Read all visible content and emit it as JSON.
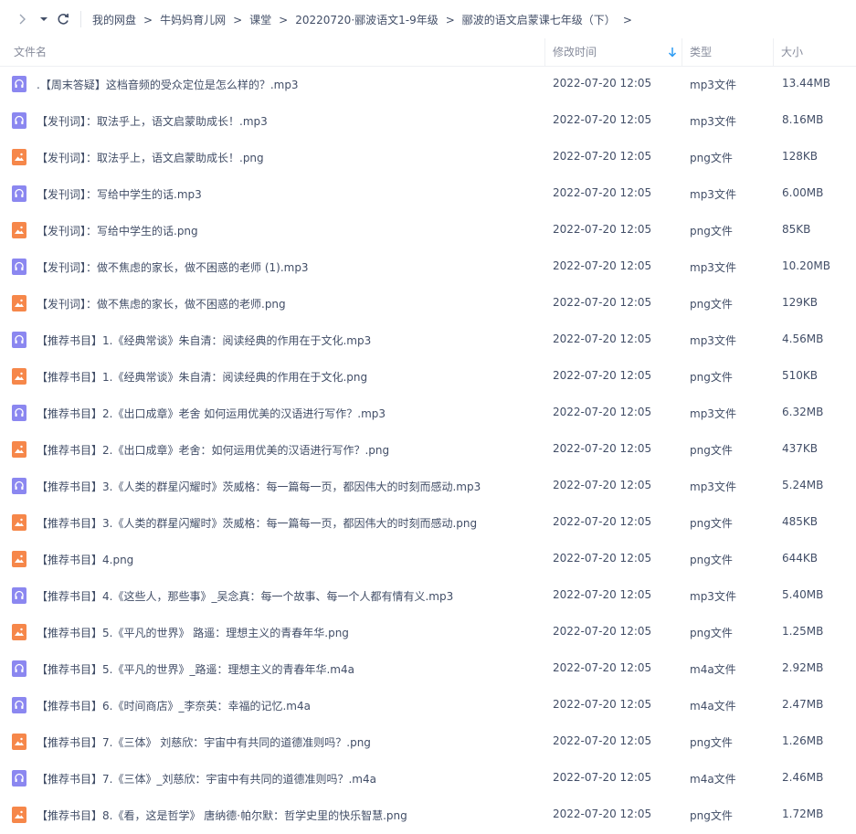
{
  "toolbar": {
    "forward_icon": "chevron-right-icon",
    "dropdown_icon": "caret-down-icon",
    "refresh_icon": "refresh-icon",
    "breadcrumb": [
      "我的网盘",
      "牛妈妈育儿网",
      "课堂",
      "20220720·郦波语文1-9年级",
      "郦波的语文启蒙课七年级（下）"
    ]
  },
  "columns": {
    "name": "文件名",
    "modified": "修改时间",
    "type": "类型",
    "size": "大小",
    "sort_icon": "sort-down-arrow-icon"
  },
  "colors": {
    "audio_icon": "#8b87f0",
    "image_icon": "#f6874a",
    "sort_accent": "#2b9af3"
  },
  "files": [
    {
      "kind": "audio",
      "name": ".【周末答疑】这档音频的受众定位是怎么样的？.mp3",
      "modified": "2022-07-20 12:05",
      "type": "mp3文件",
      "size": "13.44MB"
    },
    {
      "kind": "audio",
      "name": "【发刊词】：取法乎上，语文启蒙助成长！.mp3",
      "modified": "2022-07-20 12:05",
      "type": "mp3文件",
      "size": "8.16MB"
    },
    {
      "kind": "image",
      "name": "【发刊词】：取法乎上，语文启蒙助成长！.png",
      "modified": "2022-07-20 12:05",
      "type": "png文件",
      "size": "128KB"
    },
    {
      "kind": "audio",
      "name": "【发刊词】：写给中学生的话.mp3",
      "modified": "2022-07-20 12:05",
      "type": "mp3文件",
      "size": "6.00MB"
    },
    {
      "kind": "image",
      "name": "【发刊词】：写给中学生的话.png",
      "modified": "2022-07-20 12:05",
      "type": "png文件",
      "size": "85KB"
    },
    {
      "kind": "audio",
      "name": "【发刊词】：做不焦虑的家长，做不困惑的老师 (1).mp3",
      "modified": "2022-07-20 12:05",
      "type": "mp3文件",
      "size": "10.20MB"
    },
    {
      "kind": "image",
      "name": "【发刊词】：做不焦虑的家长，做不困惑的老师.png",
      "modified": "2022-07-20 12:05",
      "type": "png文件",
      "size": "129KB"
    },
    {
      "kind": "audio",
      "name": "【推荐书目】1.《经典常谈》朱自清：阅读经典的作用在于文化.mp3",
      "modified": "2022-07-20 12:05",
      "type": "mp3文件",
      "size": "4.56MB"
    },
    {
      "kind": "image",
      "name": "【推荐书目】1.《经典常谈》朱自清：阅读经典的作用在于文化.png",
      "modified": "2022-07-20 12:05",
      "type": "png文件",
      "size": "510KB"
    },
    {
      "kind": "audio",
      "name": "【推荐书目】2.《出口成章》老舍 如何运用优美的汉语进行写作？.mp3",
      "modified": "2022-07-20 12:05",
      "type": "mp3文件",
      "size": "6.32MB"
    },
    {
      "kind": "image",
      "name": "【推荐书目】2.《出口成章》老舍：如何运用优美的汉语进行写作？.png",
      "modified": "2022-07-20 12:05",
      "type": "png文件",
      "size": "437KB"
    },
    {
      "kind": "audio",
      "name": "【推荐书目】3.《人类的群星闪耀时》茨威格：每一篇每一页，都因伟大的时刻而感动.mp3",
      "modified": "2022-07-20 12:05",
      "type": "mp3文件",
      "size": "5.24MB"
    },
    {
      "kind": "image",
      "name": "【推荐书目】3.《人类的群星闪耀时》茨威格：每一篇每一页，都因伟大的时刻而感动.png",
      "modified": "2022-07-20 12:05",
      "type": "png文件",
      "size": "485KB"
    },
    {
      "kind": "image",
      "name": "【推荐书目】4.png",
      "modified": "2022-07-20 12:05",
      "type": "png文件",
      "size": "644KB"
    },
    {
      "kind": "audio",
      "name": "【推荐书目】4.《这些人，那些事》_吴念真：每一个故事、每一个人都有情有义.mp3",
      "modified": "2022-07-20 12:05",
      "type": "mp3文件",
      "size": "5.40MB"
    },
    {
      "kind": "image",
      "name": "【推荐书目】5.《平凡的世界》 路遥：理想主义的青春年华.png",
      "modified": "2022-07-20 12:05",
      "type": "png文件",
      "size": "1.25MB"
    },
    {
      "kind": "audio",
      "name": "【推荐书目】5.《平凡的世界》_路遥：理想主义的青春年华.m4a",
      "modified": "2022-07-20 12:05",
      "type": "m4a文件",
      "size": "2.92MB"
    },
    {
      "kind": "audio",
      "name": "【推荐书目】6.《时间商店》_李奈英：幸福的记忆.m4a",
      "modified": "2022-07-20 12:05",
      "type": "m4a文件",
      "size": "2.47MB"
    },
    {
      "kind": "image",
      "name": "【推荐书目】7.《三体》 刘慈欣：宇宙中有共同的道德准则吗？.png",
      "modified": "2022-07-20 12:05",
      "type": "png文件",
      "size": "1.26MB"
    },
    {
      "kind": "audio",
      "name": "【推荐书目】7.《三体》_刘慈欣：宇宙中有共同的道德准则吗？.m4a",
      "modified": "2022-07-20 12:05",
      "type": "m4a文件",
      "size": "2.46MB"
    },
    {
      "kind": "image",
      "name": "【推荐书目】8.《看，这是哲学》 唐纳德·帕尔默：哲学史里的快乐智慧.png",
      "modified": "2022-07-20 12:05",
      "type": "png文件",
      "size": "1.72MB"
    }
  ]
}
